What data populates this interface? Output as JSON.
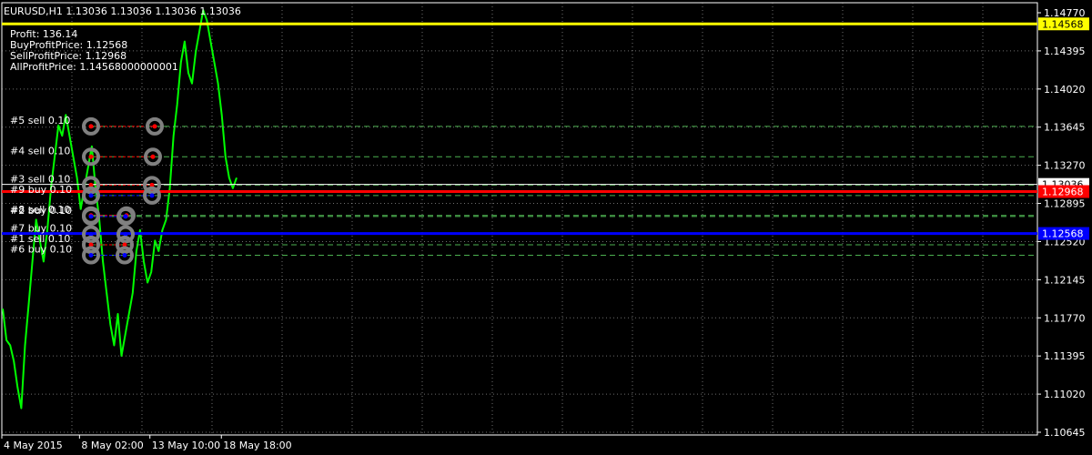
{
  "window": {
    "header": "EURUSD,H1  1.13036 1.13036 1.13036 1.13036"
  },
  "info": {
    "profit": "Profit: 136.14",
    "buy_profit_price": "BuyProfitPrice: 1.12568",
    "sell_profit_price": "SellProfitPrice: 1.12968",
    "all_profit_price": "AllProfitPrice: 1.14568000000001"
  },
  "colors": {
    "background": "#000000",
    "grid": "#c8c8c8",
    "axis": "#ffffff",
    "price": "#00ff00",
    "all_profit_line": "#ffff00",
    "sell_profit_line": "#ff0000",
    "buy_profit_line": "#0000ff",
    "order_level": "#4caf50",
    "marker_ring": "#808080",
    "sell_dot": "#ff0000",
    "buy_dot": "#0000ff"
  },
  "chart_data": {
    "type": "line",
    "symbol": "EURUSD",
    "timeframe": "H1",
    "ylim": [
      1.10645,
      1.1477
    ],
    "y_ticks": [
      "1.14770",
      "1.14395",
      "1.14020",
      "1.13645",
      "1.13270",
      "1.12895",
      "1.12520",
      "1.12145",
      "1.11770",
      "1.11395",
      "1.11020",
      "1.10645"
    ],
    "x_ticks": [
      {
        "label": "4 May 2015",
        "pos": 0.0
      },
      {
        "label": "8 May 02:00",
        "pos": 0.075
      },
      {
        "label": "13 May 10:00",
        "pos": 0.143
      },
      {
        "label": "18 May 18:00",
        "pos": 0.212
      }
    ],
    "series": [
      {
        "values": [
          1.1185,
          1.1155,
          1.115,
          1.1135,
          1.111,
          1.109,
          1.115,
          1.119,
          1.123,
          1.127,
          1.125,
          1.123,
          1.126,
          1.13,
          1.133,
          1.136,
          1.135,
          1.137,
          1.135,
          1.133,
          1.131,
          1.128,
          1.13,
          1.132,
          1.134,
          1.13,
          1.127,
          1.123,
          1.12,
          1.117,
          1.115,
          1.118,
          1.114,
          1.116,
          1.118,
          1.12,
          1.124,
          1.126,
          1.123,
          1.121,
          1.122,
          1.125,
          1.124,
          1.126,
          1.127,
          1.13,
          1.135,
          1.138,
          1.142,
          1.144,
          1.141,
          1.14,
          1.143,
          1.145,
          1.147,
          1.146,
          1.144,
          1.142,
          1.14,
          1.137,
          1.133,
          1.131,
          1.13,
          1.131
        ]
      }
    ],
    "levels": [
      {
        "name": "all-profit",
        "value": 1.14568,
        "label": "1.14568",
        "color": "#ffff00",
        "label_bg": "#ffff00",
        "label_color": "#000000"
      },
      {
        "name": "current-price",
        "value": 1.13036,
        "label": "1.13036",
        "color": "#ffffff",
        "label_bg": "#ffffff",
        "label_color": "#000000"
      },
      {
        "name": "sell-profit",
        "value": 1.12968,
        "label": "1.12968",
        "color": "#ff0000",
        "label_bg": "#ff0000",
        "label_color": "#ffffff"
      },
      {
        "name": "buy-profit",
        "value": 1.12568,
        "label": "1.12568",
        "color": "#0000ff",
        "label_bg": "#0000ff",
        "label_color": "#ffffff"
      }
    ],
    "orders": [
      {
        "label": "#5 sell 0.10",
        "price": 1.1359,
        "side": "sell"
      },
      {
        "label": "#4 sell 0.10",
        "price": 1.133,
        "side": "sell"
      },
      {
        "label": "#3 sell 0.10",
        "price": 1.1303,
        "side": "sell"
      },
      {
        "label": "#9 buy 0.10",
        "price": 1.1293,
        "side": "buy"
      },
      {
        "label": "#8 sell 0.10",
        "price": 1.1274,
        "side": "sell"
      },
      {
        "label": "#2 buy 0.10",
        "price": 1.1273,
        "side": "buy"
      },
      {
        "label": "#7 buy 0.10",
        "price": 1.1256,
        "side": "buy"
      },
      {
        "label": "#1 sell 0.10",
        "price": 1.1246,
        "side": "sell"
      },
      {
        "label": "#6 buy 0.10",
        "price": 1.1236,
        "side": "buy"
      }
    ]
  }
}
